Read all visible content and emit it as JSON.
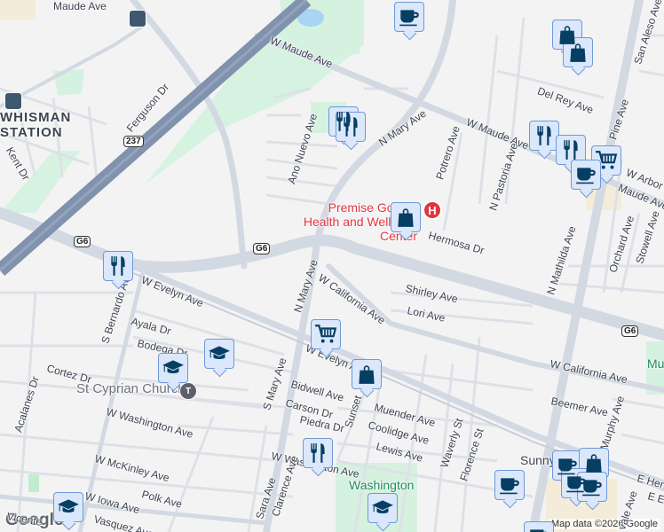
{
  "map": {
    "attribution": "Map data ©2026 Google",
    "logo": "Google",
    "route_shields": [
      "237",
      "G6",
      "G6",
      "G6"
    ],
    "places": {
      "station": "WHISMAN STATION",
      "hospital_poi": "Premise Google Health and Wellness Center",
      "church": "St Cyprian Church",
      "park": "Washington",
      "park_partial": "Mu",
      "town_partial": "Sunny"
    },
    "hospital_marker": "H",
    "transit_marker": "T",
    "streets": [
      "W Maude Ave",
      "Maude Ave",
      "Ferguson Dr",
      "Kent Dr",
      "Ano Nuevo Ave",
      "N Mary Ave",
      "Potrero Ave",
      "W Maude Ave",
      "N Pastoria Ave",
      "Del Rey Ave",
      "San Aleso Ave",
      "Pine Ave",
      "W Arbor",
      "Maude Ave",
      "Hermosa Dr",
      "N Mathilda Ave",
      "Orchard Ave",
      "Stowell Ave",
      "Shirley Ave",
      "Lori Ave",
      "W California Ave",
      "W Evelyn Ave",
      "S Bernardo Ave",
      "Ayala Dr",
      "Bodega Dr",
      "Cortez Dr",
      "Acalanes Dr",
      "W Washington Ave",
      "W McKinley Ave",
      "Polk Ave",
      "W Iowa Ave",
      "Vasquez Ave",
      "S Mary Ave",
      "Bidwell Ave",
      "Carson Dr",
      "Piedra Dr",
      "W Washington Ave",
      "Sara Ave",
      "Clarence Ave",
      "Sunset",
      "Muender Ave",
      "Coolidge Ave",
      "Lewis Ave",
      "Waverly St",
      "Florence St",
      "W California Ave",
      "Beemer Ave",
      "Murphy Ave",
      "E Hend",
      "E E",
      "N Mary Ave",
      "W Evelyn Ave",
      "Vicente",
      "vale Ave"
    ],
    "pins": [
      {
        "icon": "coffee-icon"
      },
      {
        "icon": "shopping-bag-icon"
      },
      {
        "icon": "shopping-bag-icon"
      },
      {
        "icon": "restaurant-icon"
      },
      {
        "icon": "restaurant-icon"
      },
      {
        "icon": "restaurant-icon"
      },
      {
        "icon": "restaurant-icon"
      },
      {
        "icon": "grocery-cart-icon"
      },
      {
        "icon": "coffee-icon"
      },
      {
        "icon": "shopping-bag-icon"
      },
      {
        "icon": "restaurant-icon"
      },
      {
        "icon": "grocery-cart-icon"
      },
      {
        "icon": "shopping-bag-icon"
      },
      {
        "icon": "school-icon"
      },
      {
        "icon": "school-icon"
      },
      {
        "icon": "restaurant-icon"
      },
      {
        "icon": "school-icon"
      },
      {
        "icon": "coffee-icon"
      },
      {
        "icon": "coffee-icon"
      },
      {
        "icon": "shopping-bag-icon"
      },
      {
        "icon": "coffee-icon"
      },
      {
        "icon": "coffee-icon"
      },
      {
        "icon": "school-icon"
      },
      {
        "icon": "coffee-icon"
      }
    ]
  }
}
